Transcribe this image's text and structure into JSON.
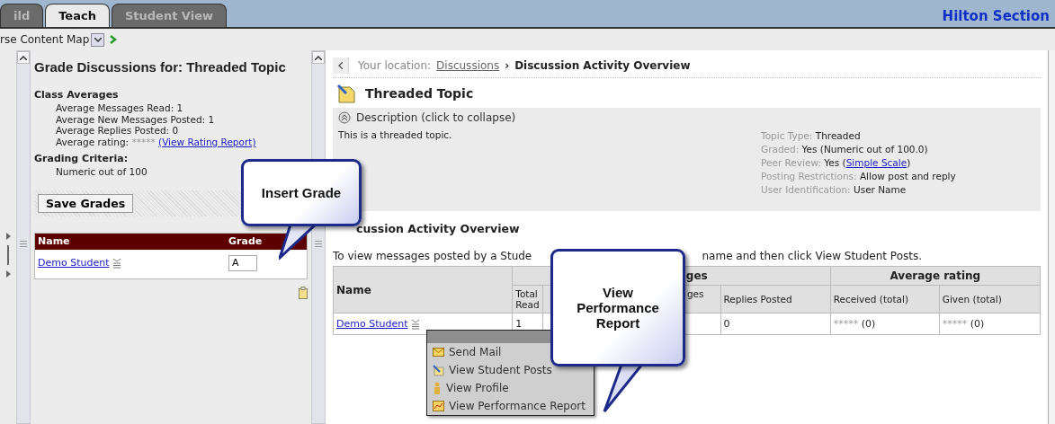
{
  "tabs": [
    {
      "label": "ild",
      "selected": false
    },
    {
      "label": "Teach",
      "selected": true
    },
    {
      "label": "Student View",
      "selected": false
    }
  ],
  "section_title": "Hilton Section",
  "toolbar": {
    "course_map": "rse Content Map"
  },
  "grade_panel": {
    "title": "Grade Discussions for: Threaded Topic",
    "averages_heading": "Class Averages",
    "averages": [
      "Average Messages Read: 1",
      "Average New Messages Posted: 1",
      "Average Replies Posted: 0"
    ],
    "rating_label": "Average rating:",
    "rating_stars": "*****",
    "rating_link": "(View Rating Report)",
    "criteria_heading": "Grading Criteria:",
    "criteria_value": "Numeric out of 100",
    "save_button": "Save Grades",
    "columns": [
      "Name",
      "Grade"
    ],
    "rows": [
      {
        "name": "Demo Student",
        "grade": "A"
      }
    ]
  },
  "breadcrumb": {
    "prefix": "Your location:",
    "link": "Discussions",
    "separator": "›",
    "current": "Discussion Activity Overview"
  },
  "topic": {
    "title": "Threaded Topic",
    "description_toggle": "Description (click to collapse)",
    "expanded": true,
    "description": "This is a threaded topic.",
    "properties": [
      {
        "label": "Topic Type:",
        "value": "Threaded"
      },
      {
        "label": "Graded:",
        "value": "Yes (Numeric out of 100.0)"
      },
      {
        "label": "Peer Review:",
        "value": "Yes (",
        "link": "Simple Scale",
        "after": ")"
      },
      {
        "label": "Posting Restrictions:",
        "value": "Allow post and reply"
      },
      {
        "label": "User Identification:",
        "value": "User Name"
      }
    ]
  },
  "overview": {
    "heading": "cussion Activity Overview",
    "instruction_start": "To view messages posted by a Stude",
    "instruction_end": "name and then click View Student Posts.",
    "name_column": "Name",
    "messages_group": "ges",
    "rating_group": "Average rating",
    "columns": [
      "Total Read",
      "ges",
      "Replies Posted",
      "Received (total)",
      "Given (total)"
    ],
    "rows": [
      {
        "name": "Demo Student",
        "total_read": "1",
        "replies": "0",
        "received_rating": "*****",
        "received_count": "(0)",
        "given_rating": "*****",
        "given_count": "(0)"
      }
    ]
  },
  "context_menu": {
    "items": [
      {
        "label": "Send Mail",
        "kind": "mail"
      },
      {
        "label": "View Student Posts",
        "kind": "posts"
      },
      {
        "label": "View Profile",
        "kind": "profile"
      },
      {
        "label": "View Performance Report",
        "kind": "report"
      }
    ]
  },
  "callouts": [
    {
      "text": "Insert Grade"
    },
    {
      "text": "View Performance Report"
    }
  ]
}
